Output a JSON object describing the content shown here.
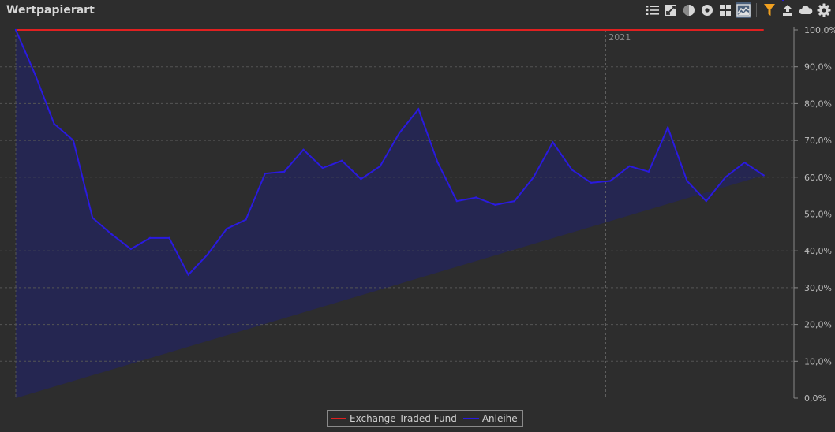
{
  "header": {
    "title": "Wertpapierart"
  },
  "toolbar": {
    "buttons": [
      {
        "name": "list-view-icon"
      },
      {
        "name": "treemap-icon"
      },
      {
        "name": "pie-chart-icon"
      },
      {
        "name": "donut-chart-icon"
      },
      {
        "name": "grid-view-icon"
      },
      {
        "name": "area-chart-icon",
        "active": true
      },
      {
        "name": "filter-icon"
      },
      {
        "name": "export-icon"
      },
      {
        "name": "cloud-icon"
      },
      {
        "name": "settings-icon"
      }
    ],
    "filter_color": "#f0a020",
    "icon_color": "#d8d8d8"
  },
  "colors": {
    "background": "#2d2d2d",
    "etf_fill": "#582626",
    "anleihe_fill": "#252651",
    "etf_line": "#e02020",
    "anleihe_line": "#2a1adf",
    "grid": "#555555",
    "tick_text": "#bdbdbd"
  },
  "chart_data": {
    "type": "area",
    "stacked": true,
    "ylim": [
      0,
      100
    ],
    "yticks": [
      "0,0%",
      "10,0%",
      "20,0%",
      "30,0%",
      "40,0%",
      "50,0%",
      "60,0%",
      "70,0%",
      "80,0%",
      "90,0%",
      "100,0%"
    ],
    "year_marker": {
      "label": "2021",
      "index": 31
    },
    "x": [
      0,
      1,
      2,
      3,
      4,
      5,
      6,
      7,
      8,
      9,
      10,
      11,
      12,
      13,
      14,
      15,
      16,
      17,
      18,
      19,
      20,
      21,
      22,
      23,
      24,
      25,
      26,
      27,
      28,
      29,
      30,
      31,
      32,
      33,
      34,
      35,
      36,
      37,
      38,
      39,
      40
    ],
    "series": [
      {
        "name": "Exchange Traded Fund",
        "values": [
          0,
          12,
          25.5,
          30,
          51,
          55.5,
          59.5,
          56.5,
          56.5,
          66.5,
          61,
          54,
          51.5,
          39,
          38.5,
          32.5,
          37.5,
          35.5,
          40.5,
          37,
          28,
          21.5,
          36,
          46.5,
          45.5,
          47.5,
          46.5,
          40,
          30.5,
          38,
          41.5,
          41,
          37,
          38.5,
          26.5,
          41,
          46.5,
          40,
          36,
          39.5
        ]
      },
      {
        "name": "Anleihe",
        "values": [
          100,
          88,
          74.5,
          70,
          49,
          44.5,
          40.5,
          43.5,
          43.5,
          33.5,
          39,
          46,
          48.5,
          61,
          61.5,
          67.5,
          62.5,
          64.5,
          59.5,
          63,
          72,
          78.5,
          64,
          53.5,
          54.5,
          52.5,
          53.5,
          60,
          69.5,
          62,
          58.5,
          59,
          63,
          61.5,
          73.5,
          59,
          53.5,
          60,
          64,
          60.5
        ]
      }
    ]
  }
}
